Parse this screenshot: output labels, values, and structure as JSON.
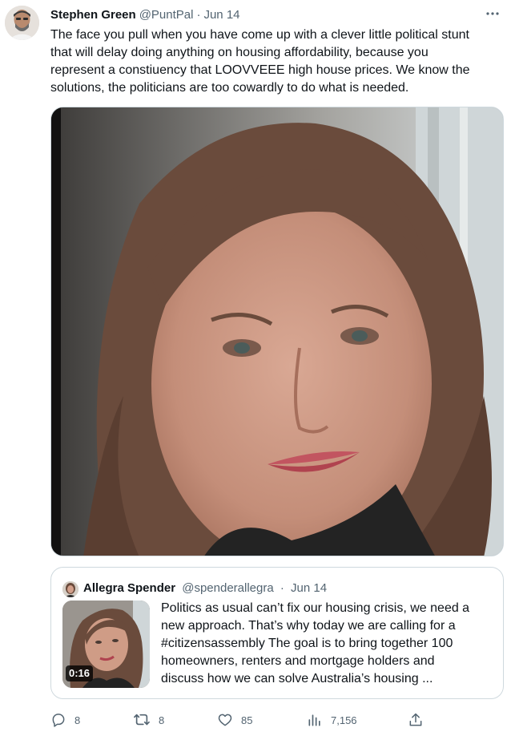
{
  "tweet": {
    "author": {
      "display_name": "Stephen Green",
      "handle": "@PuntPal",
      "separator": "·",
      "date": "Jun 14"
    },
    "text_lines": [
      "The face you pull when you have come up with a clever little political stunt",
      "that will delay doing anything on housing affordability, because you",
      "represent a constiuency that LOOVVEEE high house prices. We know the",
      "solutions, the politicians are too cowardly to do what is needed."
    ],
    "icons": {
      "more": "more-horizontal-icon"
    }
  },
  "quote": {
    "author": {
      "display_name": "Allegra Spender",
      "handle": "@spenderallegra",
      "separator": "·",
      "date": "Jun 14"
    },
    "video_duration": "0:16",
    "text_lines": [
      "Politics as usual can’t fix our housing crisis, we need a",
      "new approach. That’s why today we are calling for a",
      "#citizensassembly The goal is to bring together 100",
      "homeowners, renters and mortgage holders and",
      "discuss how we can solve Australia’s housing ..."
    ]
  },
  "actions": {
    "reply_count": "8",
    "retweet_count": "8",
    "like_count": "85",
    "view_count": "7,156",
    "icons": [
      "reply-icon",
      "retweet-icon",
      "like-icon",
      "views-icon",
      "share-icon"
    ]
  },
  "colors": {
    "text_primary": "#0f1419",
    "text_secondary": "#536471",
    "border": "#cfd9de"
  }
}
